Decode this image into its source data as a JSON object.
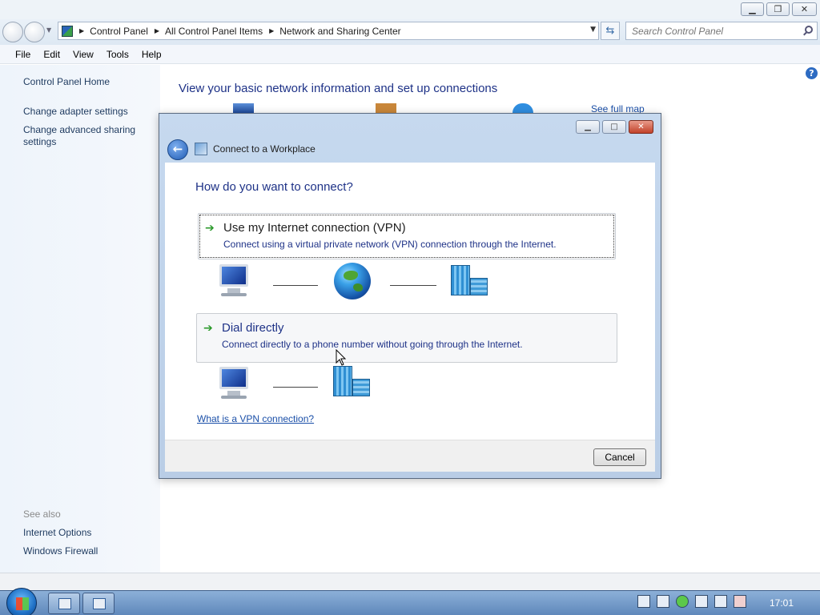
{
  "explorer": {
    "address": {
      "crumbs": [
        "Control Panel",
        "All Control Panel Items",
        "Network and Sharing Center"
      ]
    },
    "search": {
      "placeholder": "Search Control Panel"
    },
    "menu": [
      "File",
      "Edit",
      "View",
      "Tools",
      "Help"
    ],
    "leftnav": {
      "home": "Control Panel Home",
      "adapter": "Change adapter settings",
      "sharing_line1": "Change advanced sharing",
      "sharing_line2": "settings",
      "see_also": "See also",
      "internet_options": "Internet Options",
      "firewall": "Windows Firewall"
    },
    "main": {
      "heading": "View your basic network information and set up connections",
      "see_full_map": "See full map"
    }
  },
  "dialog": {
    "title": "Connect to a Workplace",
    "heading": "How do you want to connect?",
    "options": [
      {
        "title": "Use my Internet connection (VPN)",
        "description": "Connect using a virtual private network (VPN) connection through the Internet."
      },
      {
        "title": "Dial directly",
        "description": "Connect directly to a phone number without going through the Internet."
      }
    ],
    "vpn_link": "What is a VPN connection?",
    "cancel": "Cancel"
  },
  "taskbar": {
    "clock": "17:01"
  },
  "colors": {
    "heading_blue": "#1e3287",
    "link_blue": "#1a4fa8",
    "arrow_green": "#2c9a2c"
  }
}
